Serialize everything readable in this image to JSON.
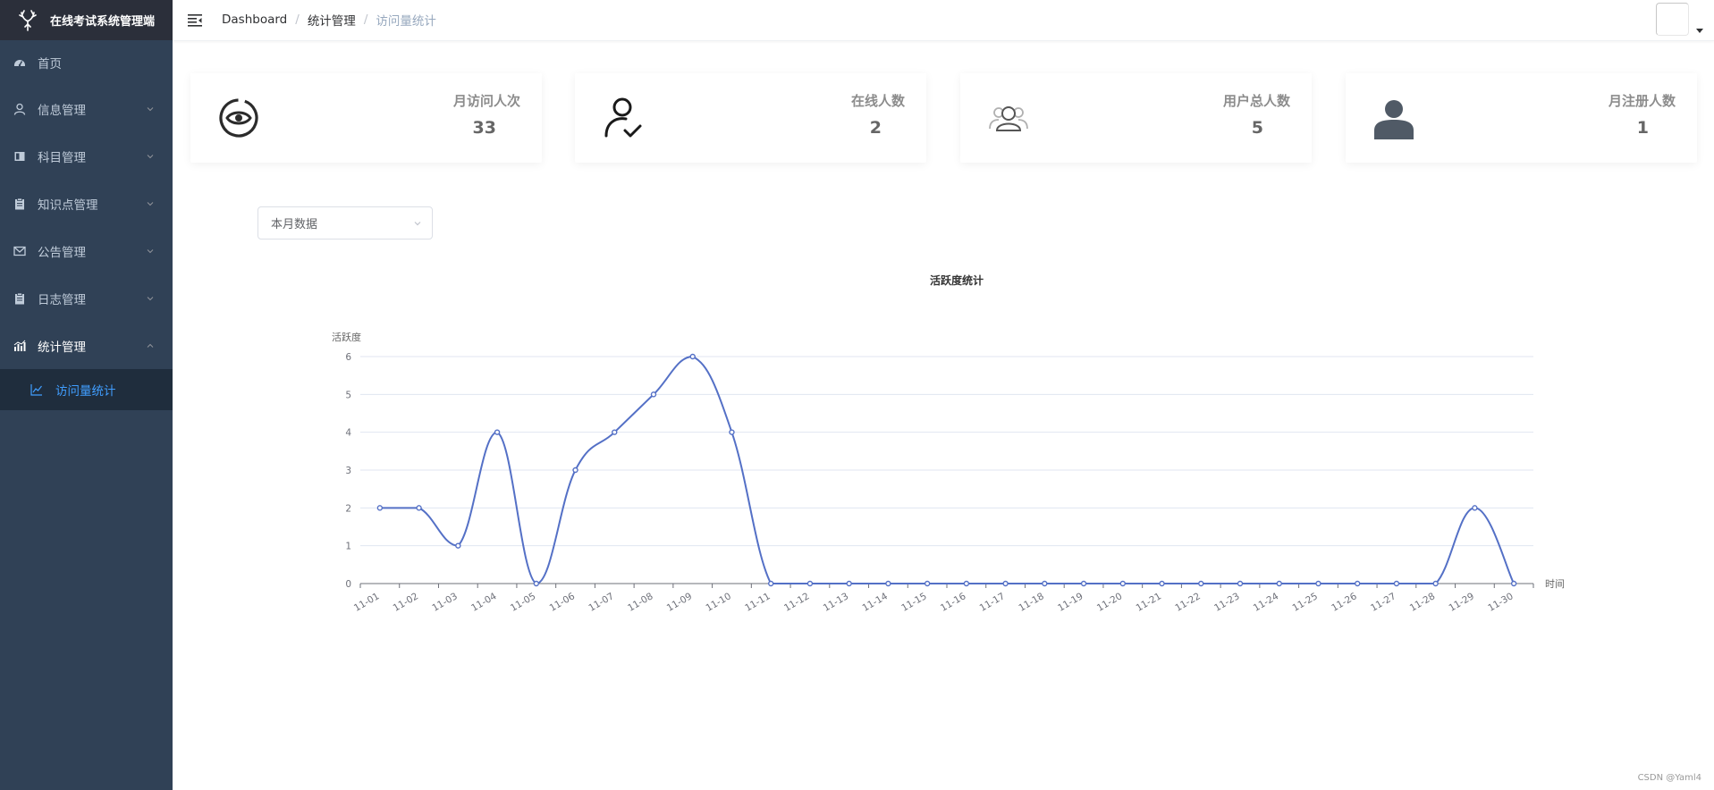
{
  "app": {
    "title": "在线考试系统管理端"
  },
  "sidebar": {
    "items": [
      {
        "label": "首页",
        "icon": "dashboard-icon"
      },
      {
        "label": "信息管理",
        "icon": "user-icon"
      },
      {
        "label": "科目管理",
        "icon": "book-icon"
      },
      {
        "label": "知识点管理",
        "icon": "clipboard-icon"
      },
      {
        "label": "公告管理",
        "icon": "mail-icon"
      },
      {
        "label": "日志管理",
        "icon": "clipboard-icon"
      },
      {
        "label": "统计管理",
        "icon": "bar-chart-icon"
      }
    ],
    "submenu": {
      "label": "访问量统计",
      "icon": "line-chart-icon"
    }
  },
  "breadcrumb": [
    "Dashboard",
    "统计管理",
    "访问量统计"
  ],
  "cards": [
    {
      "label": "月访问人次",
      "value": "33",
      "icon": "eye-icon"
    },
    {
      "label": "在线人数",
      "value": "2",
      "icon": "user-check-icon"
    },
    {
      "label": "用户总人数",
      "value": "5",
      "icon": "users-icon"
    },
    {
      "label": "月注册人数",
      "value": "1",
      "icon": "person-icon"
    }
  ],
  "filter": {
    "selected": "本月数据"
  },
  "colors": {
    "sidebar": "#304156",
    "accent": "#409eff",
    "line": "#5470c6"
  },
  "chart_data": {
    "type": "line",
    "title": "活跃度统计",
    "ylabel": "活跃度",
    "xlabel": "时间",
    "categories": [
      "11-01",
      "11-02",
      "11-03",
      "11-04",
      "11-05",
      "11-06",
      "11-07",
      "11-08",
      "11-09",
      "11-10",
      "11-11",
      "11-12",
      "11-13",
      "11-14",
      "11-15",
      "11-16",
      "11-17",
      "11-18",
      "11-19",
      "11-20",
      "11-21",
      "11-22",
      "11-23",
      "11-24",
      "11-25",
      "11-26",
      "11-27",
      "11-28",
      "11-29",
      "11-30"
    ],
    "values": [
      2,
      2,
      1,
      4,
      0,
      3,
      4,
      5,
      6,
      4,
      0,
      0,
      0,
      0,
      0,
      0,
      0,
      0,
      0,
      0,
      0,
      0,
      0,
      0,
      0,
      0,
      0,
      0,
      2,
      0
    ],
    "ylim": [
      0,
      6
    ],
    "yticks": [
      0,
      1,
      2,
      3,
      4,
      5,
      6
    ],
    "smooth": true,
    "grid": true
  },
  "watermark": "CSDN @Yaml4"
}
